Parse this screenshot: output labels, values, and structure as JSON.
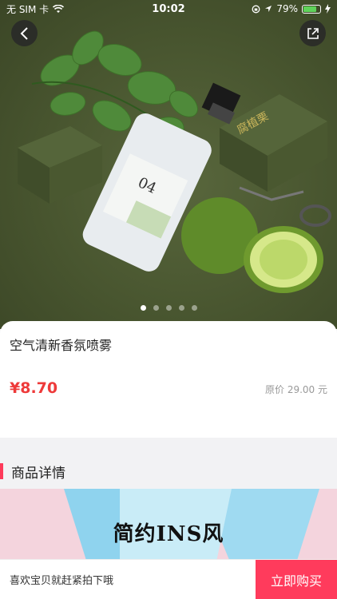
{
  "status": {
    "carrier": "无 SIM 卡",
    "time": "10:02",
    "battery": "79%",
    "battery_level": 0.79
  },
  "hero": {
    "brand": "腐植栗",
    "number": "04",
    "slide_count": 5,
    "active_slide": 1
  },
  "product": {
    "title": "空气清新香氛喷雾",
    "price": "¥8.70",
    "original_price": "原价 29.00 元"
  },
  "details": {
    "heading": "商品详情",
    "banner_text": "简约INS风"
  },
  "bottom": {
    "hint": "喜欢宝贝就赶紧拍下哦",
    "buy_label": "立即购买"
  },
  "icons": [
    "back-icon",
    "share-icon",
    "wifi-icon",
    "location-icon",
    "rotation-lock-icon",
    "charging-icon"
  ]
}
